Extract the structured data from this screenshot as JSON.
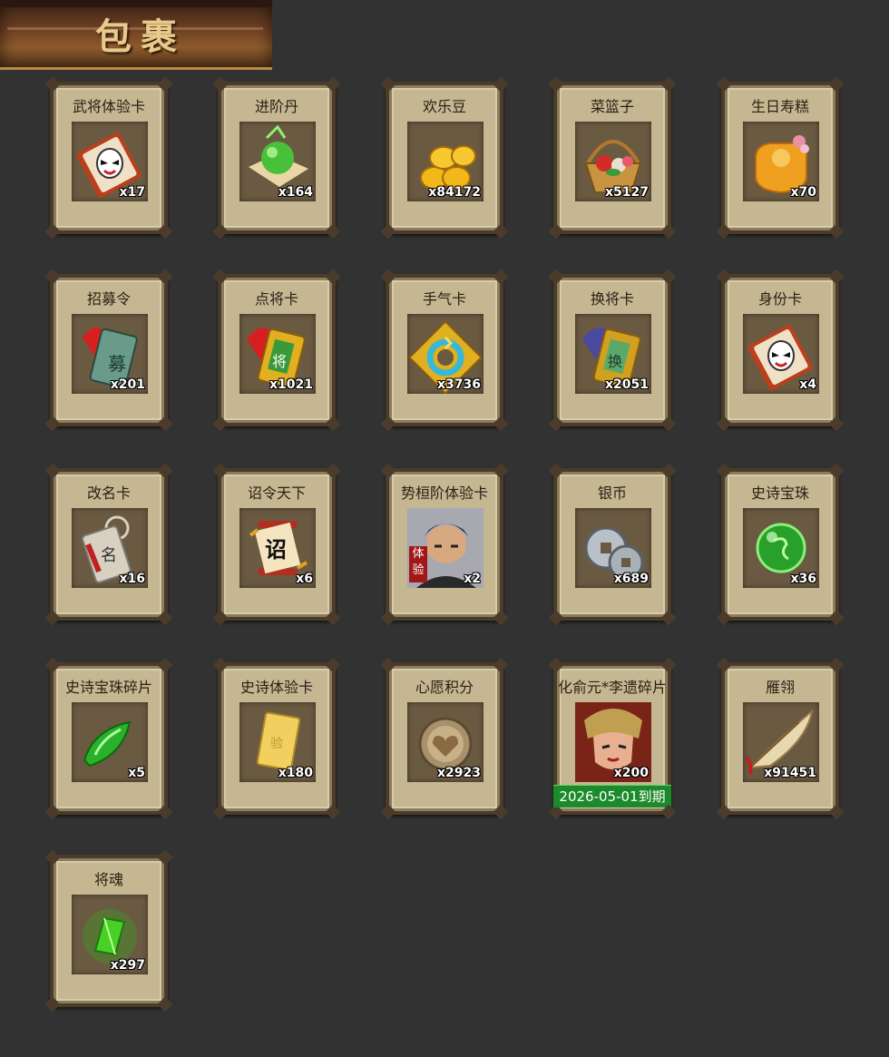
{
  "header": {
    "title": "包裹"
  },
  "items": [
    {
      "name": "武将体验卡",
      "count": "x17",
      "icon": "opera-mask-card-icon"
    },
    {
      "name": "进阶丹",
      "count": "x164",
      "icon": "green-pill-icon"
    },
    {
      "name": "欢乐豆",
      "count": "x84172",
      "icon": "gold-beans-icon"
    },
    {
      "name": "菜篮子",
      "count": "x5127",
      "icon": "flower-basket-icon"
    },
    {
      "name": "生日寿糕",
      "count": "x70",
      "icon": "birthday-cake-icon"
    },
    {
      "name": "招募令",
      "count": "x201",
      "icon": "recruit-token-icon"
    },
    {
      "name": "点将卡",
      "count": "x1021",
      "icon": "general-select-card-icon"
    },
    {
      "name": "手气卡",
      "count": "x3736",
      "icon": "luck-card-icon"
    },
    {
      "name": "换将卡",
      "count": "x2051",
      "icon": "swap-general-card-icon"
    },
    {
      "name": "身份卡",
      "count": "x4",
      "icon": "identity-card-icon"
    },
    {
      "name": "改名卡",
      "count": "x16",
      "icon": "rename-card-icon"
    },
    {
      "name": "诏令天下",
      "count": "x6",
      "icon": "imperial-scroll-icon"
    },
    {
      "name": "势桓阶体验卡",
      "count": "x2",
      "icon": "general-portrait-icon",
      "badge": "体验"
    },
    {
      "name": "银币",
      "count": "x689",
      "icon": "silver-coins-icon"
    },
    {
      "name": "史诗宝珠",
      "count": "x36",
      "icon": "epic-orb-icon"
    },
    {
      "name": "史诗宝珠碎片",
      "count": "x5",
      "icon": "orb-shard-icon"
    },
    {
      "name": "史诗体验卡",
      "count": "x180",
      "icon": "gold-card-icon"
    },
    {
      "name": "心愿积分",
      "count": "x2923",
      "icon": "heart-coin-icon"
    },
    {
      "name": "化俞元*李遗碎片",
      "count": "x200",
      "icon": "hero-fragment-icon",
      "expire": "2026-05-01到期"
    },
    {
      "name": "雁翎",
      "count": "x91451",
      "icon": "feather-icon"
    },
    {
      "name": "将魂",
      "count": "x297",
      "icon": "soul-crystal-icon"
    }
  ],
  "colors": {
    "background": "#323232",
    "card": "#c5b792",
    "card_border": "#4b3b2b",
    "icon_bg": "#6a5a42",
    "expire_bar": "#1b8a2a"
  }
}
